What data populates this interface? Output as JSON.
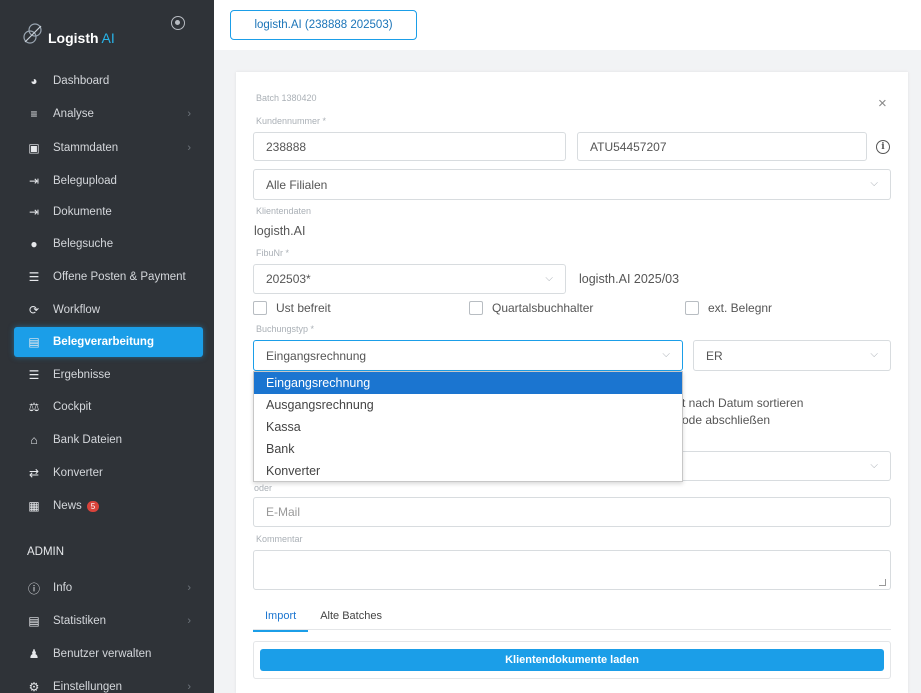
{
  "sidebar": {
    "brand": "Logisth",
    "brand_ai": "AI",
    "items": [
      {
        "label": "Dashboard",
        "icon": "pie-chart-icon",
        "glyph": "◕",
        "chevron": false,
        "active": false,
        "badge": ""
      },
      {
        "label": "Analyse",
        "icon": "analytics-icon",
        "glyph": "≡",
        "chevron": true,
        "active": false,
        "badge": ""
      },
      {
        "label": "Stammdaten",
        "icon": "id-card-icon",
        "glyph": "▣",
        "chevron": true,
        "active": false,
        "badge": ""
      },
      {
        "label": "Belegupload",
        "icon": "file-import-icon",
        "glyph": "⇥",
        "chevron": false,
        "active": false,
        "badge": ""
      },
      {
        "label": "Dokumente",
        "icon": "file-import-icon",
        "glyph": "⇥",
        "chevron": false,
        "active": false,
        "badge": ""
      },
      {
        "label": "Belegsuche",
        "icon": "search-file-icon",
        "glyph": "●",
        "chevron": false,
        "active": false,
        "badge": ""
      },
      {
        "label": "Offene Posten & Payment",
        "icon": "list-icon",
        "glyph": "☰",
        "chevron": false,
        "active": false,
        "badge": ""
      },
      {
        "label": "Workflow",
        "icon": "handshake-icon",
        "glyph": "⟳",
        "chevron": false,
        "active": false,
        "badge": ""
      },
      {
        "label": "Belegverarbeitung",
        "icon": "document-icon",
        "glyph": "▤",
        "chevron": false,
        "active": true,
        "badge": ""
      },
      {
        "label": "Ergebnisse",
        "icon": "menu-icon",
        "glyph": "☰",
        "chevron": false,
        "active": false,
        "badge": ""
      },
      {
        "label": "Cockpit",
        "icon": "scale-icon",
        "glyph": "⚖",
        "chevron": false,
        "active": false,
        "badge": ""
      },
      {
        "label": "Bank Dateien",
        "icon": "bank-icon",
        "glyph": "⌂",
        "chevron": false,
        "active": false,
        "badge": ""
      },
      {
        "label": "Konverter",
        "icon": "exchange-icon",
        "glyph": "⇄",
        "chevron": false,
        "active": false,
        "badge": ""
      },
      {
        "label": "News",
        "icon": "newspaper-icon",
        "glyph": "▦",
        "chevron": false,
        "active": false,
        "badge": "5"
      }
    ],
    "admin_heading": "ADMIN",
    "admin_items": [
      {
        "label": "Info",
        "icon": "info-circle-icon",
        "glyph": "ⓘ",
        "chevron": true
      },
      {
        "label": "Statistiken",
        "icon": "statistics-icon",
        "glyph": "▤",
        "chevron": true
      },
      {
        "label": "Benutzer verwalten",
        "icon": "users-icon",
        "glyph": "♟",
        "chevron": false
      },
      {
        "label": "Einstellungen",
        "icon": "cogs-icon",
        "glyph": "⚙",
        "chevron": true
      }
    ]
  },
  "topbar": {
    "client_tab": "logisth.AI (238888 202503)"
  },
  "form": {
    "batch_label": "Batch 1380420",
    "close_symbol": "×",
    "kundennummer_label": "Kundennummer *",
    "kundennummer_value": "238888",
    "uid_value": "ATU54457207",
    "filialen_value": "Alle Filialen",
    "klientendaten_label": "Klientendaten",
    "klient_name": "logisth.AI",
    "fibunr_label": "FibuNr *",
    "fibunr_value": "202503*",
    "fibunr_desc": "logisth.AI 2025/03",
    "ust_befreit": "Ust befreit",
    "quartalsbuchhalter": "Quartalsbuchhalter",
    "ext_belegnr": "ext. Belegnr",
    "buchungstyp_label": "Buchungstyp *",
    "buchungstyp_value": "Eingangsrechnung",
    "buchungstyp_code": "ER",
    "options": [
      "Eingangsrechnung",
      "Ausgangsrechnung",
      "Kassa",
      "Bank",
      "Konverter"
    ],
    "selected_option": "Eingangsrechnung",
    "hidden_text_1": "t nach Datum sortieren",
    "hidden_text_2": "ode abschließen",
    "oder_label": "oder",
    "email_placeholder": "E-Mail",
    "kommentar_label": "Kommentar"
  },
  "tabs": [
    "Import",
    "Alte Batches"
  ],
  "load_button": "Klientendokumente laden",
  "colors": {
    "accent": "#1b9ee8",
    "sidebar_bg": "#2f3338",
    "selected_option": "#1b75d0"
  }
}
